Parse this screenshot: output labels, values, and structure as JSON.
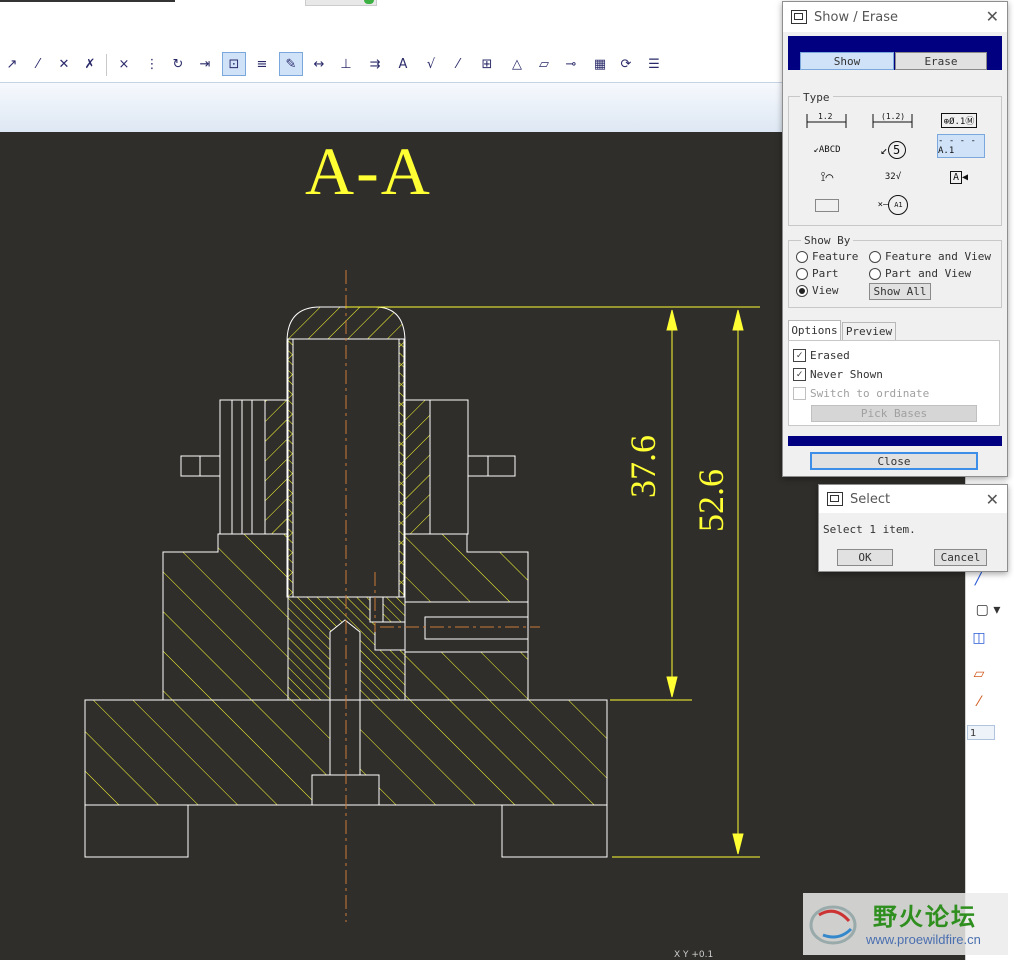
{
  "drawing": {
    "section_label": "A-A",
    "dim_1": "37.6",
    "dim_2": "52.6",
    "status_text": "X Y  +0.1"
  },
  "show_erase": {
    "title": "Show / Erase",
    "show_tab": "Show",
    "erase_tab": "Erase",
    "type_label": "Type",
    "type_items": [
      "1.2 dimension",
      "(1.2) reference dimension",
      "geometric tolerance",
      "ABCD note",
      "balloon 5",
      "datum axis A.1",
      "weld symbol",
      "surface finish 32",
      "datum feature A",
      "cosmetic feature",
      "datum target A1"
    ],
    "type_texts": {
      "dim": "1.2",
      "refdim": "(1.2)",
      "gtol": "⊕Ø.1Ⓜ",
      "note": "ABCD",
      "balloon": "5",
      "axis": "A.1",
      "finish": "32",
      "datum": "A",
      "target": "A1"
    },
    "show_by_label": "Show By",
    "radio_feature": "Feature",
    "radio_feature_view": "Feature and View",
    "radio_part": "Part",
    "radio_part_view": "Part and View",
    "radio_view": "View",
    "show_all": "Show All",
    "options_tab": "Options",
    "preview_tab": "Preview",
    "check_erased": "Erased",
    "check_never_shown": "Never Shown",
    "check_switch": "Switch to ordinate",
    "pick_bases": "Pick Bases",
    "close": "Close"
  },
  "select_dialog": {
    "title": "Select",
    "message": "Select 1 item.",
    "ok": "OK",
    "cancel": "Cancel"
  },
  "right_panel": {
    "spinner_value": "1"
  },
  "watermark": {
    "chinese": "野火论坛",
    "url": "www.proewildfire.cn"
  },
  "colors": {
    "canvas": "#2f2e2a",
    "yellow": "#ffff33",
    "white": "#ffffff",
    "centerline": "#c87a3a",
    "navy": "#000080"
  }
}
